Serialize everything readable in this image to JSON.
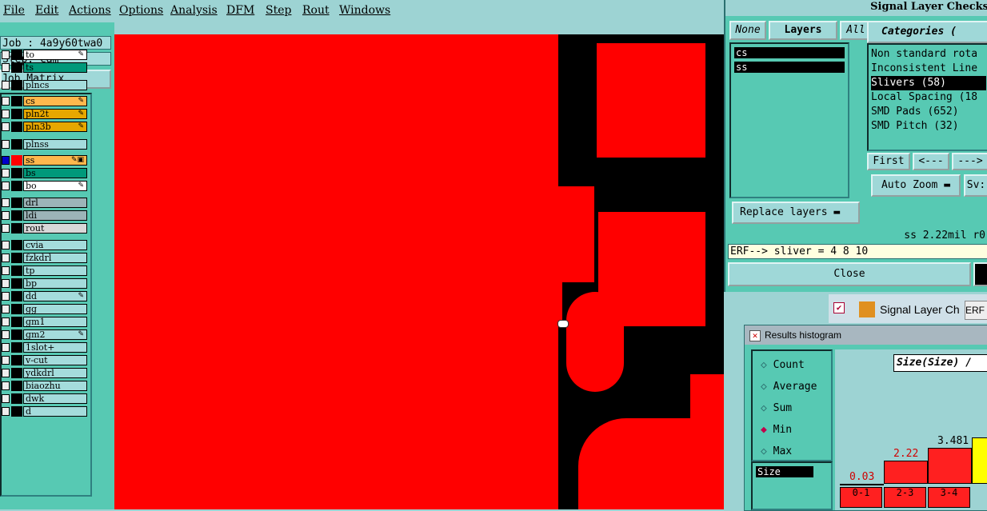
{
  "menubar": {
    "items": [
      "File",
      "Edit",
      "Actions",
      "Options",
      "Analysis",
      "DFM",
      "Step",
      "Rout",
      "Windows"
    ]
  },
  "job": {
    "job_label": "Job : 4a9y60twa0",
    "step_label": "Step: cam",
    "matrix_button": "Job Matrix ..."
  },
  "layers": [
    {
      "name": "to",
      "color": "#ffffff",
      "marker": "✎"
    },
    {
      "name": "ts",
      "color": "#00997a",
      "marker": ""
    },
    {
      "name": "plncs",
      "color": "#a4dcdc",
      "marker": ""
    },
    {
      "name": "cs",
      "color": "#ffb84d",
      "marker": "✎"
    },
    {
      "name": "pln2t",
      "color": "#e6a700",
      "marker": "✎"
    },
    {
      "name": "pln3b",
      "color": "#e6a700",
      "marker": "✎"
    },
    {
      "name": "plnss",
      "color": "#a4dcdc",
      "marker": ""
    },
    {
      "name": "ss",
      "color": "#ffb84d",
      "marker": "✎▣"
    },
    {
      "name": "bs",
      "color": "#00997a",
      "marker": ""
    },
    {
      "name": "bo",
      "color": "#ffffff",
      "marker": "✎"
    },
    {
      "name": "drl",
      "color": "#9cb4b8",
      "marker": ""
    },
    {
      "name": "ldi",
      "color": "#9cb4b8",
      "marker": ""
    },
    {
      "name": "rout",
      "color": "#d8d8d8",
      "marker": ""
    },
    {
      "name": "cvia",
      "color": "#a4dcdc",
      "marker": ""
    },
    {
      "name": "fzkdrl",
      "color": "#a4dcdc",
      "marker": ""
    },
    {
      "name": "tp",
      "color": "#a4dcdc",
      "marker": ""
    },
    {
      "name": "bp",
      "color": "#a4dcdc",
      "marker": ""
    },
    {
      "name": "dd",
      "color": "#a4dcdc",
      "marker": "✎"
    },
    {
      "name": "gg",
      "color": "#a4dcdc",
      "marker": ""
    },
    {
      "name": "gm1",
      "color": "#a4dcdc",
      "marker": ""
    },
    {
      "name": "gm2",
      "color": "#a4dcdc",
      "marker": "✎"
    },
    {
      "name": "1slot+",
      "color": "#a4dcdc",
      "marker": ""
    },
    {
      "name": "v-cut",
      "color": "#a4dcdc",
      "marker": ""
    },
    {
      "name": "ydkdrl",
      "color": "#a4dcdc",
      "marker": ""
    },
    {
      "name": "biaozhu",
      "color": "#a4dcdc",
      "marker": ""
    },
    {
      "name": "dwk",
      "color": "#a4dcdc",
      "marker": ""
    },
    {
      "name": "d",
      "color": "#a4dcdc",
      "marker": ""
    }
  ],
  "slc": {
    "title": "Signal Layer Checks",
    "none_btn": "None",
    "layers_tab": "Layers",
    "all_btn": "All",
    "categories_tab": "Categories (",
    "selected_layers": [
      "cs",
      "ss"
    ],
    "categories": [
      "Non standard rota",
      "Inconsistent Line",
      "Slivers (58)",
      "Local Spacing (18",
      "SMD Pads (652)",
      "SMD Pitch (32)"
    ],
    "first_btn": "First",
    "prev_btn": "<---",
    "next_btn": "--->",
    "autozoom_btn": "Auto Zoom",
    "sv_label": "Sv:",
    "replace_btn": "Replace layers",
    "status": "ss 2.22mil  r0",
    "erf": "ERF--> sliver = 4 8 10",
    "close_btn": "Close"
  },
  "strip": {
    "label": "Signal Layer Ch",
    "erf_label": "ERF"
  },
  "histogram": {
    "title": "Results histogram",
    "modes": [
      "Count",
      "Average",
      "Sum",
      "Min",
      "Max"
    ],
    "selected_mode": "Min",
    "size_item": "Size",
    "size_header": "Size(Size) /",
    "bars": [
      {
        "value": "0.03",
        "bin": "0-1"
      },
      {
        "value": "2.22",
        "bin": "2-3"
      },
      {
        "value": "3.481",
        "bin": "3-4"
      }
    ]
  }
}
